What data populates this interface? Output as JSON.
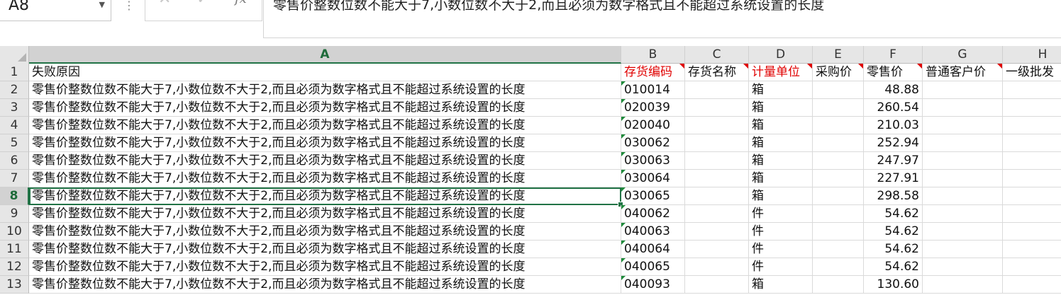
{
  "name_box": {
    "value": "A8"
  },
  "formula_bar": {
    "cancel_icon": "close-icon",
    "enter_icon": "check-icon",
    "fx_label": "fx",
    "content": "零售价整数位数不能大于7,小数位数不大于2,而且必须为数字格式且不能超过系统设置的长度"
  },
  "columns": [
    "A",
    "B",
    "C",
    "D",
    "E",
    "F",
    "G",
    "H"
  ],
  "header_row": {
    "row_number": "1",
    "cells": [
      "失败原因",
      "存货编码",
      "存货名称",
      "计量单位",
      "采购价",
      "零售价",
      "普通客户价",
      "一级批发"
    ]
  },
  "rows": [
    {
      "row_number": "2",
      "reason": "零售价整数位数不能大于7,小数位数不大于2,而且必须为数字格式且不能超过系统设置的长度",
      "code": "010014",
      "name": "",
      "unit": "箱",
      "purchase_price": "",
      "retail_price": "48.88",
      "customer_price": "",
      "wholesale": ""
    },
    {
      "row_number": "3",
      "reason": "零售价整数位数不能大于7,小数位数不大于2,而且必须为数字格式且不能超过系统设置的长度",
      "code": "020039",
      "name": "",
      "unit": "箱",
      "purchase_price": "",
      "retail_price": "260.54",
      "customer_price": "",
      "wholesale": ""
    },
    {
      "row_number": "4",
      "reason": "零售价整数位数不能大于7,小数位数不大于2,而且必须为数字格式且不能超过系统设置的长度",
      "code": "020040",
      "name": "",
      "unit": "箱",
      "purchase_price": "",
      "retail_price": "210.03",
      "customer_price": "",
      "wholesale": ""
    },
    {
      "row_number": "5",
      "reason": "零售价整数位数不能大于7,小数位数不大于2,而且必须为数字格式且不能超过系统设置的长度",
      "code": "030062",
      "name": "",
      "unit": "箱",
      "purchase_price": "",
      "retail_price": "252.94",
      "customer_price": "",
      "wholesale": ""
    },
    {
      "row_number": "6",
      "reason": "零售价整数位数不能大于7,小数位数不大于2,而且必须为数字格式且不能超过系统设置的长度",
      "code": "030063",
      "name": "",
      "unit": "箱",
      "purchase_price": "",
      "retail_price": "247.97",
      "customer_price": "",
      "wholesale": ""
    },
    {
      "row_number": "7",
      "reason": "零售价整数位数不能大于7,小数位数不大于2,而且必须为数字格式且不能超过系统设置的长度",
      "code": "030064",
      "name": "",
      "unit": "箱",
      "purchase_price": "",
      "retail_price": "227.91",
      "customer_price": "",
      "wholesale": ""
    },
    {
      "row_number": "8",
      "reason": "零售价整数位数不能大于7,小数位数不大于2,而且必须为数字格式且不能超过系统设置的长度",
      "code": "030065",
      "name": "",
      "unit": "箱",
      "purchase_price": "",
      "retail_price": "298.58",
      "customer_price": "",
      "wholesale": ""
    },
    {
      "row_number": "9",
      "reason": "零售价整数位数不能大于7,小数位数不大于2,而且必须为数字格式且不能超过系统设置的长度",
      "code": "040062",
      "name": "",
      "unit": "件",
      "purchase_price": "",
      "retail_price": "54.62",
      "customer_price": "",
      "wholesale": ""
    },
    {
      "row_number": "10",
      "reason": "零售价整数位数不能大于7,小数位数不大于2,而且必须为数字格式且不能超过系统设置的长度",
      "code": "040063",
      "name": "",
      "unit": "件",
      "purchase_price": "",
      "retail_price": "54.62",
      "customer_price": "",
      "wholesale": ""
    },
    {
      "row_number": "11",
      "reason": "零售价整数位数不能大于7,小数位数不大于2,而且必须为数字格式且不能超过系统设置的长度",
      "code": "040064",
      "name": "",
      "unit": "件",
      "purchase_price": "",
      "retail_price": "54.62",
      "customer_price": "",
      "wholesale": ""
    },
    {
      "row_number": "12",
      "reason": "零售价整数位数不能大于7,小数位数不大于2,而且必须为数字格式且不能超过系统设置的长度",
      "code": "040065",
      "name": "",
      "unit": "件",
      "purchase_price": "",
      "retail_price": "54.62",
      "customer_price": "",
      "wholesale": ""
    },
    {
      "row_number": "13",
      "reason": "零售价整数位数不能大于7,小数位数不大于2,而且必须为数字格式且不能超过系统设置的长度",
      "code": "040093",
      "name": "",
      "unit": "箱",
      "purchase_price": "",
      "retail_price": "130.60",
      "customer_price": "",
      "wholesale": ""
    }
  ],
  "selection": {
    "active_cell": "A8",
    "selected_column": "A",
    "selected_row": "8"
  },
  "colors": {
    "selection_accent": "#217346",
    "required_header_text": "#e00000",
    "comment_marker": "#e00000",
    "text_number_marker": "#1e8a3a"
  }
}
